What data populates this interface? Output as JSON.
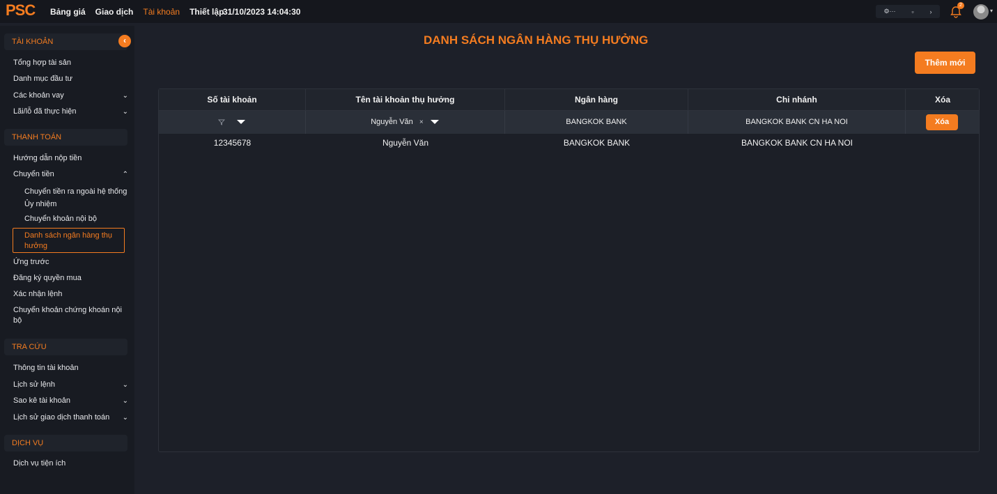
{
  "topbar": {
    "logo": "PSC",
    "nav": [
      "Bảng giá",
      "Giao dịch",
      "Tài khoản",
      "Thiết lập"
    ],
    "active_nav": "Tài khoản",
    "datetime": "31/10/2023 14:04:30",
    "notification_count": "2"
  },
  "sidebar": {
    "sections": {
      "tai_khoan": "TÀI KHOẢN",
      "thanh_toan": "THANH TOÁN",
      "tra_cuu": "TRA CỨU",
      "dich_vu": "DỊCH VỤ"
    },
    "tai_khoan_items": [
      "Tổng hợp tài sản",
      "Danh mục đầu tư",
      "Các khoản vay",
      "Lãi/lỗ đã thực hiện"
    ],
    "thanh_toan_items": {
      "huong_dan": "Hướng dẫn nộp tiền",
      "chuyen_tien": "Chuyển tiền",
      "sub": [
        "Chuyển tiền ra ngoài hệ thống Ủy nhiệm",
        "Chuyển khoản nội bộ",
        "Danh sách ngân hàng thụ hưởng"
      ],
      "after": [
        "Ứng trước",
        "Đăng ký quyền mua",
        "Xác nhận lệnh",
        "Chuyển khoản chứng khoán nội bộ"
      ]
    },
    "tra_cuu_items": [
      "Thông tin tài khoản",
      "Lịch sử lệnh",
      "Sao kê tài khoản",
      "Lịch sử giao dịch thanh toán"
    ],
    "dich_vu_items": [
      "Dịch vụ tiện ích"
    ]
  },
  "main": {
    "title": "DANH SÁCH NGÂN HÀNG THỤ HƯỞNG",
    "add_button": "Thêm mới",
    "columns": [
      "Số tài khoản",
      "Tên tài khoản thụ hưởng",
      "Ngân hàng",
      "Chi nhánh",
      "Xóa"
    ],
    "filter_row": {
      "name": "Nguyễn Văn",
      "bank": "BANGKOK BANK",
      "branch": "BANGKOK BANK CN HA NOI",
      "delete": "Xóa"
    },
    "rows": [
      {
        "account": "12345678",
        "name": "Nguyễn Văn",
        "bank": "BANGKOK BANK",
        "branch": "BANGKOK BANK CN HA NOI"
      }
    ]
  },
  "colors": {
    "accent": "#f47c20",
    "background": "#1d2029",
    "sidebar": "#181b22"
  }
}
